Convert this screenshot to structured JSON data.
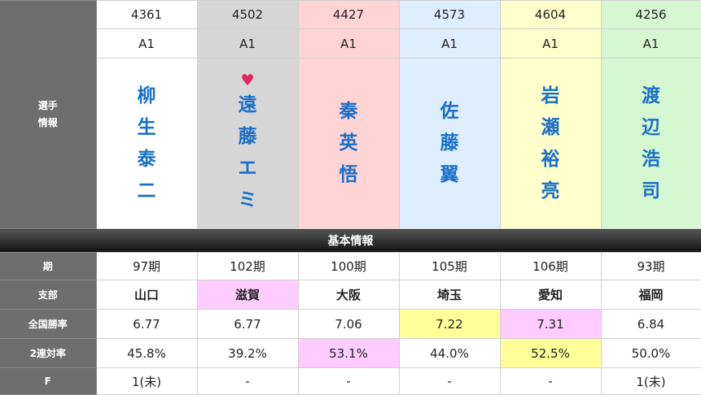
{
  "row_labels": {
    "player_info": "選手\n情報",
    "term": "期",
    "branch": "支部",
    "win_rate": "全国勝率",
    "quinella_rate": "2連対率",
    "flying": "F"
  },
  "section_title": "基本情報",
  "racers": [
    {
      "number": "4361",
      "class": "A1",
      "name": "柳生泰二",
      "term": "97期",
      "branch": "山口",
      "win_rate": "6.77",
      "quinella_rate": "45.8%",
      "flying": "1(未)"
    },
    {
      "number": "4502",
      "class": "A1",
      "name": "遠藤エミ",
      "favorite": "♥",
      "term": "102期",
      "branch": "滋賀",
      "win_rate": "6.77",
      "quinella_rate": "39.2%",
      "flying": "-"
    },
    {
      "number": "4427",
      "class": "A1",
      "name": "秦英悟",
      "term": "100期",
      "branch": "大阪",
      "win_rate": "7.06",
      "quinella_rate": "53.1%",
      "flying": "-"
    },
    {
      "number": "4573",
      "class": "A1",
      "name": "佐藤翼",
      "term": "105期",
      "branch": "埼玉",
      "win_rate": "7.22",
      "quinella_rate": "44.0%",
      "flying": "-"
    },
    {
      "number": "4604",
      "class": "A1",
      "name": "岩瀬裕亮",
      "term": "106期",
      "branch": "愛知",
      "win_rate": "7.31",
      "quinella_rate": "52.5%",
      "flying": "-"
    },
    {
      "number": "4256",
      "class": "A1",
      "name": "渡辺浩司",
      "term": "93期",
      "branch": "福岡",
      "win_rate": "6.84",
      "quinella_rate": "50.0%",
      "flying": "1(未)"
    }
  ],
  "colors": {
    "lane_backgrounds": [
      "#ffffff",
      "#d6d6d6",
      "#ffd4d4",
      "#ddeeff",
      "#ffffcc",
      "#d4f7cf"
    ],
    "highlight_pink": "#ffccff",
    "highlight_yellow": "#ffff99",
    "name_text": "#1a6fc9",
    "heart": "#e0245e"
  }
}
